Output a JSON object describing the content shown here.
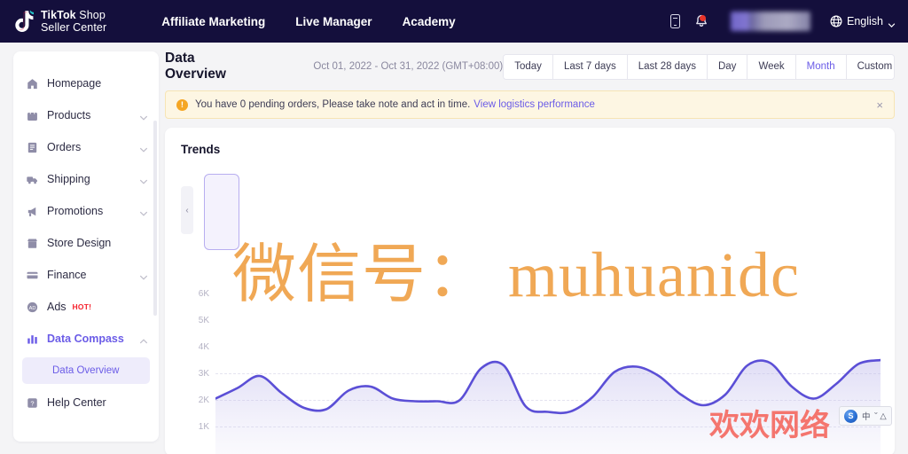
{
  "topbar": {
    "brand_line1_bold": "TikTok",
    "brand_line1_rest": " Shop",
    "brand_line2": "Seller Center",
    "brand_logo_icon": "tiktok-note-icon",
    "nav": [
      {
        "label": "Affiliate Marketing"
      },
      {
        "label": "Live Manager"
      },
      {
        "label": "Academy"
      }
    ],
    "phone_icon": "mobile-phone-icon",
    "bell_icon": "notification-bell-icon",
    "notification_dot": true,
    "avatar_label": "",
    "language": "English",
    "language_icon": "globe-icon",
    "language_chevron": "chevron-down-icon"
  },
  "sidebar": {
    "items": [
      {
        "label": "Homepage",
        "icon": "home-icon",
        "expandable": false,
        "active": false
      },
      {
        "label": "Products",
        "icon": "bag-icon",
        "expandable": true,
        "active": false
      },
      {
        "label": "Orders",
        "icon": "list-icon",
        "expandable": true,
        "active": false
      },
      {
        "label": "Shipping",
        "icon": "truck-icon",
        "expandable": true,
        "active": false
      },
      {
        "label": "Promotions",
        "icon": "megaphone-icon",
        "expandable": true,
        "active": false
      },
      {
        "label": "Store Design",
        "icon": "store-icon",
        "expandable": false,
        "active": false
      },
      {
        "label": "Finance",
        "icon": "card-icon",
        "expandable": true,
        "active": false
      },
      {
        "label": "Ads",
        "icon": "ads-icon",
        "expandable": false,
        "active": false,
        "badge": "HOT!"
      },
      {
        "label": "Data Compass",
        "icon": "bar-chart-icon",
        "expandable": true,
        "active": true,
        "expanded": true
      },
      {
        "label": "Help Center",
        "icon": "help-icon",
        "expandable": false,
        "active": false
      }
    ],
    "data_compass_children": [
      {
        "label": "Data Overview",
        "selected": true
      }
    ]
  },
  "main": {
    "page_title": "Data Overview",
    "date_range": "Oct 01, 2022 - Oct 31, 2022 (GMT+08:00)",
    "range_buttons": [
      {
        "label": "Today",
        "active": false
      },
      {
        "label": "Last 7 days",
        "active": false
      },
      {
        "label": "Last 28 days",
        "active": false
      },
      {
        "label": "Day",
        "active": false
      },
      {
        "label": "Week",
        "active": false
      },
      {
        "label": "Month",
        "active": true
      },
      {
        "label": "Custom",
        "active": false
      }
    ],
    "alert": {
      "icon": "warning-icon",
      "icon_glyph": "!",
      "text": "You have 0 pending orders, Please take note and act in time.",
      "link": "View logistics performance",
      "close_icon": "close-icon",
      "close_glyph": "×"
    },
    "trends_card": {
      "title": "Trends",
      "scroll_left_icon": "chevron-left-icon",
      "scroll_left_glyph": "‹"
    }
  },
  "chart_data": {
    "type": "line",
    "title": "Trends",
    "xlabel": "",
    "ylabel": "",
    "ylim": [
      0,
      6500
    ],
    "grid": true,
    "legend_position": "none",
    "line_color": "#5b4fd6",
    "fill_color": "#e9e7f8",
    "y_ticks": [
      "1K",
      "2K",
      "3K",
      "4K",
      "5K",
      "6K"
    ],
    "y_tick_values": [
      1000,
      2000,
      3000,
      4000,
      5000,
      6000
    ],
    "series": [
      {
        "name": "Trend",
        "values": [
          2050,
          2450,
          2900,
          2250,
          1700,
          1650,
          2350,
          2500,
          2050,
          1950,
          1950,
          1980,
          3200,
          3300,
          1750,
          1550,
          1560,
          2100,
          3050,
          3250,
          2900,
          2200,
          1800,
          2200,
          3300,
          3400,
          2500,
          2050,
          2600,
          3350,
          3500
        ]
      }
    ]
  },
  "watermarks": {
    "main": "微信号： muhuanidc",
    "corner": "欢欢网络",
    "ime_logo_text": "S",
    "ime_label": "中",
    "ime_extra": "˘ △"
  },
  "colors": {
    "brand_dark": "#140f3c",
    "accent_purple": "#6b5ce7",
    "chart_line": "#5b4fd6",
    "alert_bg": "#fdf6e3",
    "hot_red": "#f5222d",
    "watermark_orange": "#f0a855",
    "watermark_red": "#f4756e"
  }
}
